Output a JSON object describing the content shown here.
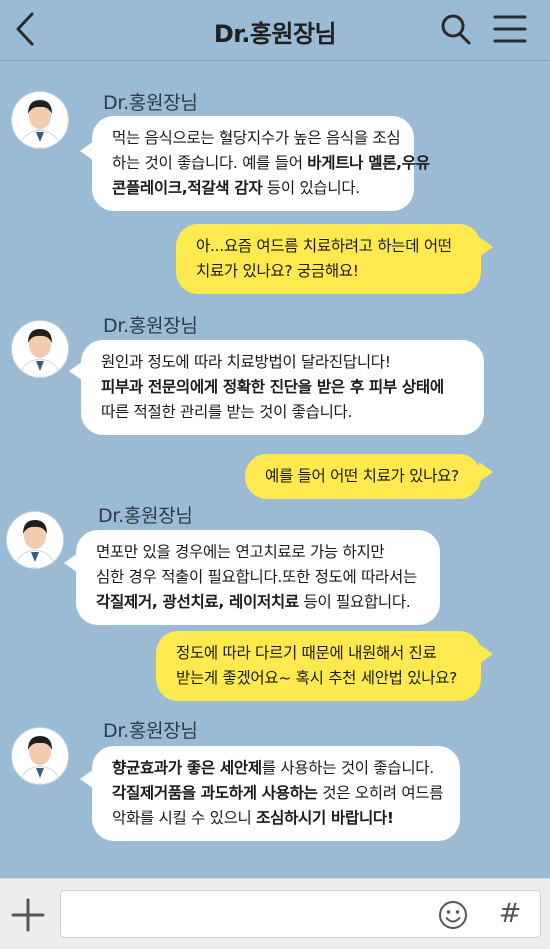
{
  "header": {
    "title": "Dr.홍원장님",
    "back_icon": "chevron-left-icon",
    "search_icon": "search-icon",
    "menu_icon": "menu-icon"
  },
  "messages": [
    {
      "sender": "Dr.홍원장님",
      "direction": "incoming",
      "lines": [
        [
          {
            "text": "먹는 음식으로는 혈당지수가 높은 음식을 조심",
            "bold": false
          }
        ],
        [
          {
            "text": "하는 것이 좋습니다. 예를 들어 ",
            "bold": false
          },
          {
            "text": "바게트나 멜론,우유",
            "bold": true
          }
        ],
        [
          {
            "text": "콘플레이크,적갈색 감자",
            "bold": true
          },
          {
            "text": " 등이 있습니다.",
            "bold": false
          }
        ]
      ]
    },
    {
      "direction": "outgoing",
      "lines": [
        [
          {
            "text": "아...요즘 여드름 치료하려고 하는데 어떤",
            "bold": false
          }
        ],
        [
          {
            "text": "치료가 있나요? 궁금해요!",
            "bold": false
          }
        ]
      ]
    },
    {
      "sender": "Dr.홍원장님",
      "direction": "incoming",
      "lines": [
        [
          {
            "text": "원인과 정도에 따라 치료방법이 달라진답니다!",
            "bold": false
          }
        ],
        [
          {
            "text": "피부과 전문의에게 정확한 진단을 받은 후 피부 상태에",
            "bold": true
          }
        ],
        [
          {
            "text": "따른 적절한 관리를 받는 것이 좋습니다.",
            "bold": false
          }
        ]
      ]
    },
    {
      "direction": "outgoing",
      "lines": [
        [
          {
            "text": "예를 들어 어떤 치료가 있나요?",
            "bold": false
          }
        ]
      ]
    },
    {
      "sender": "Dr.홍원장님",
      "direction": "incoming",
      "lines": [
        [
          {
            "text": "면포만 있을 경우에는 연고치료로 가능 하지만",
            "bold": false
          }
        ],
        [
          {
            "text": "심한 경우 적출이 필요합니다.또한 정도에 따라서는",
            "bold": false
          }
        ],
        [
          {
            "text": "각질제거, 광선치료, 레이저치료",
            "bold": true
          },
          {
            "text": " 등이 필요합니다.",
            "bold": false
          }
        ]
      ]
    },
    {
      "direction": "outgoing",
      "lines": [
        [
          {
            "text": "정도에 따라 다르기 때문에 내원해서 진료",
            "bold": false
          }
        ],
        [
          {
            "text": "받는게 좋겠어요~ 혹시 추천 세안법 있나요?",
            "bold": false
          }
        ]
      ]
    },
    {
      "sender": "Dr.홍원장님",
      "direction": "incoming",
      "lines": [
        [
          {
            "text": "향균효과가 좋은 세안제",
            "bold": true
          },
          {
            "text": "를 사용하는 것이 좋습니다.",
            "bold": false
          }
        ],
        [
          {
            "text": "각질제거품을 과도하게 사용하는",
            "bold": true
          },
          {
            "text": " 것은 오히려 여드름",
            "bold": false
          }
        ],
        [
          {
            "text": "악화를 시킬 수 있으니 ",
            "bold": false
          },
          {
            "text": "조심하시기 바랍니다!",
            "bold": true
          }
        ]
      ]
    }
  ],
  "input_bar": {
    "placeholder": "",
    "plus_icon": "plus-icon",
    "emoji_icon": "smiley-icon",
    "hash_label": "#"
  },
  "colors": {
    "background": "#9bbbd4",
    "incoming_bubble": "#ffffff",
    "outgoing_bubble": "#fee94e"
  }
}
